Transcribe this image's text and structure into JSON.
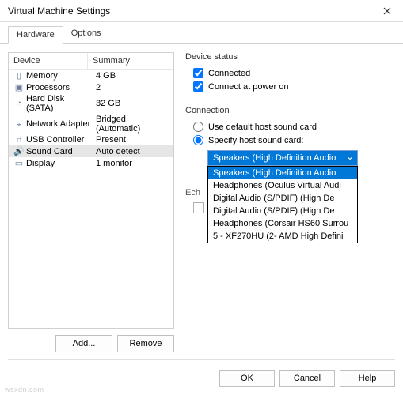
{
  "window": {
    "title": "Virtual Machine Settings"
  },
  "tabs": {
    "hardware": "Hardware",
    "options": "Options"
  },
  "table": {
    "headers": {
      "device": "Device",
      "summary": "Summary"
    },
    "rows": [
      {
        "icon": "▯",
        "device": "Memory",
        "summary": "4 GB"
      },
      {
        "icon": "▣",
        "device": "Processors",
        "summary": "2"
      },
      {
        "icon": "◔",
        "device": "Hard Disk (SATA)",
        "summary": "32 GB"
      },
      {
        "icon": "⌁",
        "device": "Network Adapter",
        "summary": "Bridged (Automatic)"
      },
      {
        "icon": "⑁",
        "device": "USB Controller",
        "summary": "Present"
      },
      {
        "icon": "🔊",
        "device": "Sound Card",
        "summary": "Auto detect"
      },
      {
        "icon": "▭",
        "device": "Display",
        "summary": "1 monitor"
      }
    ]
  },
  "left_buttons": {
    "add": "Add...",
    "remove": "Remove"
  },
  "device_status": {
    "label": "Device status",
    "connected": "Connected",
    "connect_power": "Connect at power on"
  },
  "connection": {
    "label": "Connection",
    "use_default": "Use default host sound card",
    "specify": "Specify host sound card:",
    "selected": "Speakers (High Definition Audio",
    "options": [
      "Speakers (High Definition Audio",
      "Headphones (Oculus Virtual Audi",
      "Digital Audio (S/PDIF) (High De",
      "Digital Audio (S/PDIF) (High De",
      "Headphones (Corsair HS60 Surrou",
      "5 - XF270HU (2- AMD High Defini"
    ]
  },
  "echo": {
    "label": "Ech"
  },
  "footer": {
    "ok": "OK",
    "cancel": "Cancel",
    "help": "Help"
  },
  "watermark": "wsxdn.com"
}
